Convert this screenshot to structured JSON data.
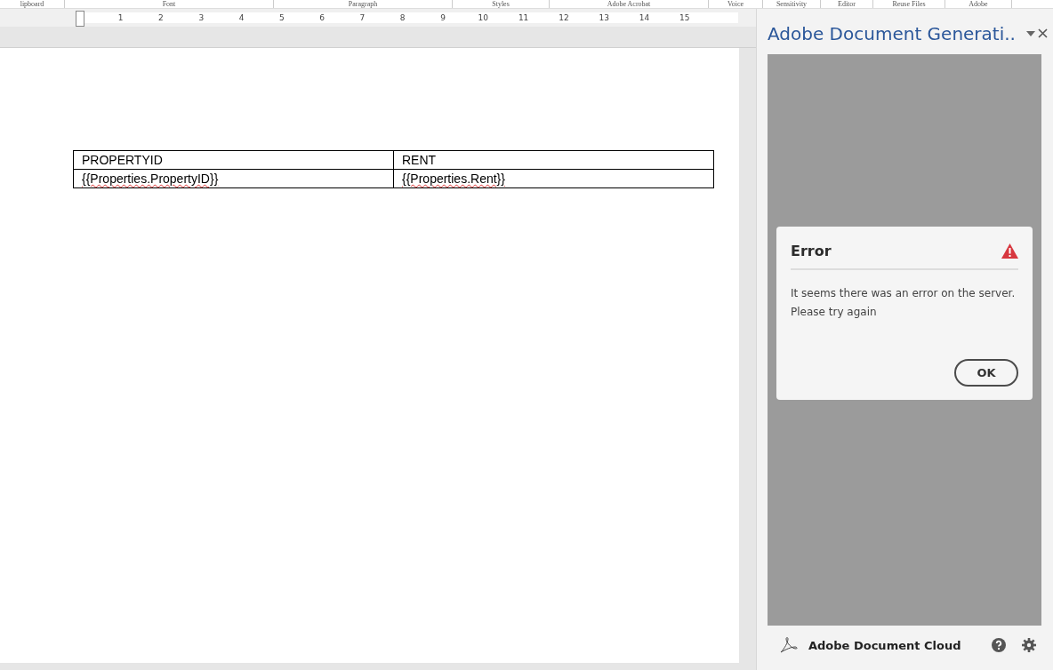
{
  "ribbon_groups": [
    {
      "label": "lipboard"
    },
    {
      "label": "Font"
    },
    {
      "label": "Paragraph"
    },
    {
      "label": "Styles"
    },
    {
      "label": "Adobe Acrobat"
    },
    {
      "label": "Voice"
    },
    {
      "label": "Sensitivity"
    },
    {
      "label": "Editor"
    },
    {
      "label": "Reuse Files"
    },
    {
      "label": "Adobe"
    }
  ],
  "ruler": {
    "numbers": [
      "1",
      "2",
      "3",
      "4",
      "5",
      "6",
      "7",
      "8",
      "9",
      "10",
      "11",
      "12",
      "13",
      "14",
      "15"
    ]
  },
  "document": {
    "table": {
      "columns": [
        "PROPERTYID",
        "RENT"
      ],
      "rows": [
        [
          "{{Properties.PropertyID}}",
          "{{Properties.Rent}}"
        ]
      ]
    }
  },
  "panel": {
    "title": "Adobe Document Generati..",
    "dialog": {
      "title": "Error",
      "message": "It seems there was an error on the server.",
      "message_2": "Please try again",
      "button": "OK"
    },
    "footer": {
      "label": "Adobe Document Cloud"
    }
  }
}
